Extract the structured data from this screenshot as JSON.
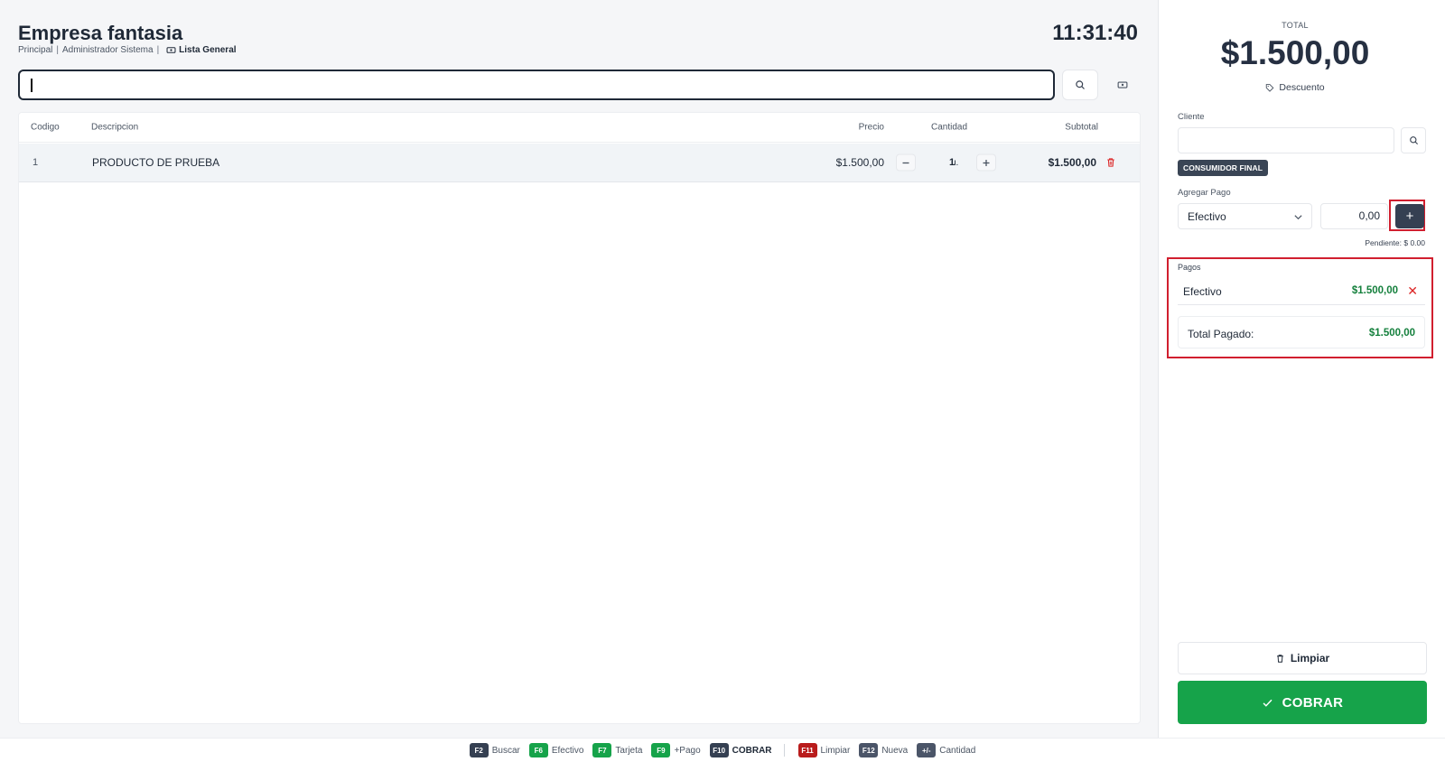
{
  "header": {
    "company": "Empresa fantasia",
    "branch": "Principal",
    "user": "Administrador Sistema",
    "price_list": "Lista General",
    "clock": "11:31:40"
  },
  "search": {
    "value": "",
    "search_icon": "search-icon",
    "cash_icon": "cash-icon"
  },
  "table": {
    "headers": {
      "code": "Codigo",
      "description": "Descripcion",
      "price": "Precio",
      "quantity": "Cantidad",
      "subtotal": "Subtotal"
    },
    "rows": [
      {
        "code": "1",
        "description": "PRODUCTO DE PRUEBA",
        "price": "$1.500,00",
        "quantity": "1",
        "unit": "u.",
        "subtotal": "$1.500,00"
      }
    ]
  },
  "sidebar": {
    "total_label": "TOTAL",
    "total": "$1.500,00",
    "discount_label": "Descuento",
    "client_label": "Cliente",
    "client_value": "",
    "client_badge": "CONSUMIDOR FINAL",
    "add_payment_label": "Agregar Pago",
    "payment_method": "Efectivo",
    "payment_amount": "0,00",
    "add_symbol": "+",
    "pending": "Pendiente: $ 0.00",
    "payments_label": "Pagos",
    "payments": [
      {
        "method": "Efectivo",
        "amount": "$1.500,00",
        "remove": "✕"
      }
    ],
    "total_paid_label": "Total Pagado:",
    "total_paid": "$1.500,00",
    "clear_label": "Limpiar",
    "charge_label": "COBRAR"
  },
  "shortcuts": [
    {
      "key": "F2",
      "label": "Buscar"
    },
    {
      "key": "F6",
      "label": "Efectivo"
    },
    {
      "key": "F7",
      "label": "Tarjeta"
    },
    {
      "key": "F9",
      "label": "+Pago"
    },
    {
      "key": "F10",
      "label": "COBRAR"
    },
    {
      "key": "F11",
      "label": "Limpiar"
    },
    {
      "key": "F12",
      "label": "Nueva"
    },
    {
      "key": "+/-",
      "label": "Cantidad"
    }
  ],
  "colors": {
    "accent": "#354052",
    "success": "#16a34a",
    "danger": "#dc2626",
    "highlight": "#d11f2f"
  }
}
